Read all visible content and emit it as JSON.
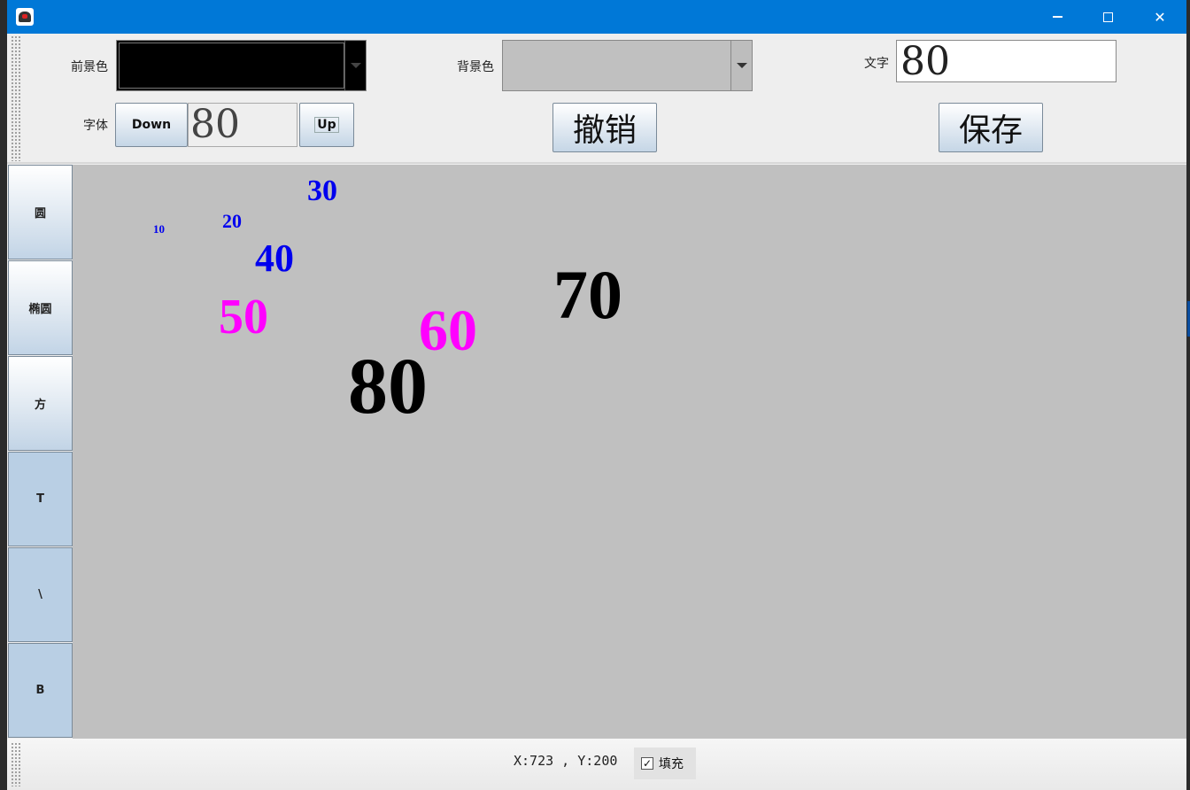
{
  "window": {
    "controls": {
      "minimize": "—",
      "maximize": "□",
      "close": "✕"
    }
  },
  "toolbar": {
    "foreground_label": "前景色",
    "foreground_color": "#000000",
    "background_label": "背景色",
    "background_color": "#c0c0c0",
    "text_label": "文字",
    "text_value": "80",
    "font_label": "字体",
    "font_down": "Down",
    "font_size": "80",
    "font_up": "Up",
    "undo": "撤销",
    "save": "保存"
  },
  "tools": [
    {
      "label": "圆"
    },
    {
      "label": "椭圆"
    },
    {
      "label": "方"
    },
    {
      "label": "T"
    },
    {
      "label": "\\"
    },
    {
      "label": "B"
    }
  ],
  "canvas": {
    "background": "#c0c0c0",
    "texts": [
      {
        "text": "10",
        "color": "#0000ee"
      },
      {
        "text": "20",
        "color": "#0000ee"
      },
      {
        "text": "30",
        "color": "#0000ee"
      },
      {
        "text": "40",
        "color": "#0000ee"
      },
      {
        "text": "50",
        "color": "#ff00ff"
      },
      {
        "text": "60",
        "color": "#ff00ff"
      },
      {
        "text": "70",
        "color": "#000000"
      },
      {
        "text": "80",
        "color": "#000000"
      }
    ]
  },
  "status": {
    "coordinates": "X:723 , Y:200",
    "fill_checked": true,
    "fill_label": "填充",
    "check_mark": "✓"
  }
}
